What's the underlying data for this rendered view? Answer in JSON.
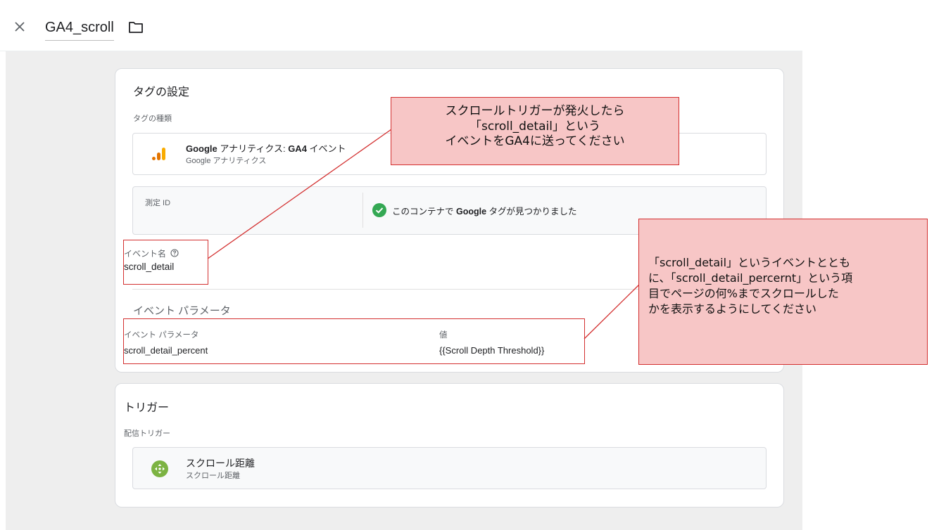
{
  "header": {
    "title": "GA4_scroll"
  },
  "tag_config": {
    "heading": "タグの設定",
    "tag_type_label": "タグの種類",
    "tag_type_name_bold1": "Google",
    "tag_type_name_mid": " アナリティクス: ",
    "tag_type_name_bold2": "GA4",
    "tag_type_name_tail": " イベント",
    "tag_type_sub": "Google アナリティクス",
    "measurement_id_label": "測定 ID",
    "measurement_status_pre": "このコンテナで ",
    "measurement_status_bold": "Google",
    "measurement_status_post": " タグが見つかりました",
    "event_name_label": "イベント名",
    "event_name_value": "scroll_detail",
    "event_params_heading": "イベント パラメータ",
    "param_col_header": "イベント パラメータ",
    "value_col_header": "値",
    "param_name": "scroll_detail_percent",
    "param_value": "{{Scroll Depth Threshold}}"
  },
  "trigger": {
    "heading": "トリガー",
    "firing_label": "配信トリガー",
    "name": "スクロール距離",
    "sub": "スクロール距離"
  },
  "annotations": {
    "note1_line1": "スクロールトリガーが発火したら",
    "note1_line2": "「scroll_detail」という",
    "note1_line3": "イベントをGA4に送ってください",
    "note2_line1": "「scroll_detail」というイベントととも",
    "note2_line2": "に、「scroll_detail_percernt」という項",
    "note2_line3": "目でページの何%までスクロールした",
    "note2_line4": "かを表示するようにしてください"
  },
  "colors": {
    "ga_orange": "#f9ab00",
    "ga_dark_orange": "#e37400",
    "check_green": "#34a853",
    "trigger_green": "#7cb342",
    "annotation_red": "#d32f2f",
    "annotation_fill": "#f7c6c6"
  }
}
